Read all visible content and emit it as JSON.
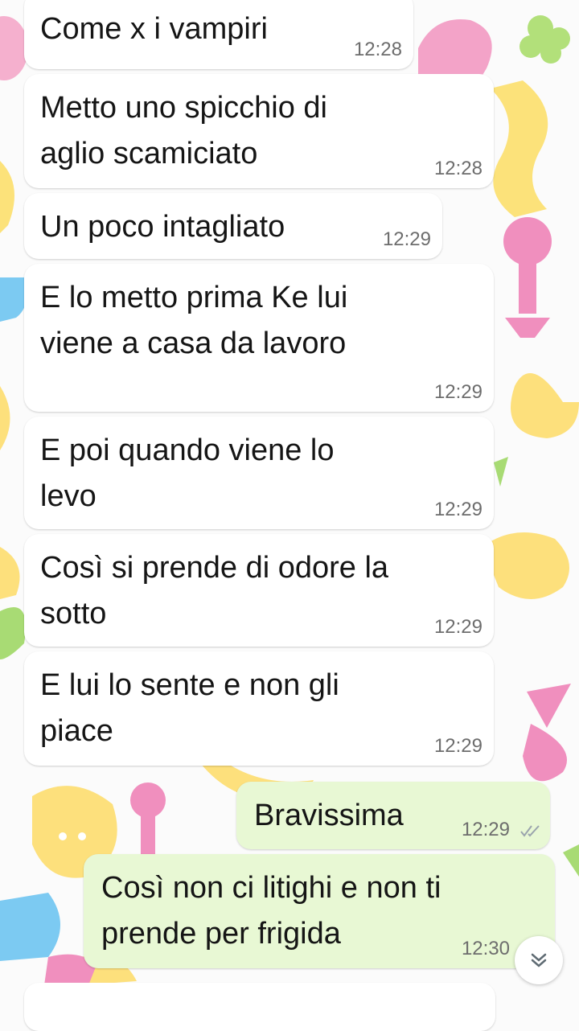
{
  "messages": [
    {
      "text": "Come x i vampiri",
      "time": "12:28",
      "dir": "in"
    },
    {
      "text": "Metto uno spicchio di\naglio scamiciato",
      "time": "12:28",
      "dir": "in"
    },
    {
      "text": "Un poco intagliato",
      "time": "12:29",
      "dir": "in"
    },
    {
      "text": "E lo metto prima Ke lui\nviene a casa da lavoro",
      "time": "12:29",
      "dir": "in"
    },
    {
      "text": "E poi quando viene lo\nlevo",
      "time": "12:29",
      "dir": "in"
    },
    {
      "text": "Così si prende di odore la\nsotto",
      "time": "12:29",
      "dir": "in"
    },
    {
      "text": "E lui lo sente e non gli\npiace",
      "time": "12:29",
      "dir": "in"
    },
    {
      "text": "Bravissima",
      "time": "12:29",
      "dir": "out",
      "status": "read"
    },
    {
      "text": "Così non ci litighi e non ti\nprende per frigida",
      "time": "12:30",
      "dir": "out",
      "status": "read"
    }
  ],
  "icons": {
    "read_receipt": "double-check-icon",
    "scroll_down": "chevron-double-down-icon"
  },
  "colors": {
    "incoming_bubble": "#ffffff",
    "outgoing_bubble": "#e8f8d4",
    "timestamp": "#6d6d6d",
    "read_ticks": "#9aa4ad"
  }
}
